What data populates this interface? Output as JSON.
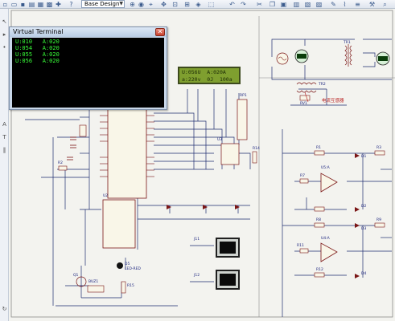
{
  "toolbar": {
    "design_select": "Base Design",
    "icons": [
      "new-icon",
      "open-icon",
      "save-icon",
      "print-icon",
      "help-icon",
      "zoom-in-icon",
      "zoom-out-icon",
      "pan-icon",
      "undo-icon",
      "redo-icon",
      "cut-icon",
      "copy-icon",
      "paste-icon",
      "block-icon",
      "pick-icon",
      "wire-icon",
      "netlist-icon",
      "tools-icon"
    ]
  },
  "terminal": {
    "title": "Virtual Terminal",
    "close_glyph": "✕",
    "lines": [
      "U:010   A:020",
      "U:054   A:020",
      "U:055   A:020",
      "U:056   A:020"
    ]
  },
  "lcd": {
    "row1": "U:056U  A:020A",
    "row2": "a:220v  0J  100a"
  },
  "labels": {
    "rp1": "RP1",
    "u3": "U3",
    "u2": "U2",
    "r14": "R14",
    "tr1": "TR1",
    "tr2": "TR2",
    "rv1": "RV1",
    "transformer_note": "电流互感器",
    "r1": "R1",
    "r3": "R3",
    "r7": "R7",
    "r8": "R8",
    "r9": "R9",
    "r11": "R11",
    "r12": "R12",
    "u5a": "U5:A",
    "u4a": "U4:A",
    "d1": "D1",
    "d2": "D2",
    "d3": "D3",
    "d4": "D4",
    "d5": "D5",
    "q1": "Q1",
    "r15": "R15",
    "r2": "R2",
    "buz": "BUZ1",
    "j1": "J11",
    "j2": "J12",
    "led_red": "LED-RED"
  },
  "colors": {
    "wire": "#1d2b6f",
    "component": "#7a1515",
    "terminal_text": "#39ff39",
    "lcd_bg": "#7f9f2f"
  }
}
